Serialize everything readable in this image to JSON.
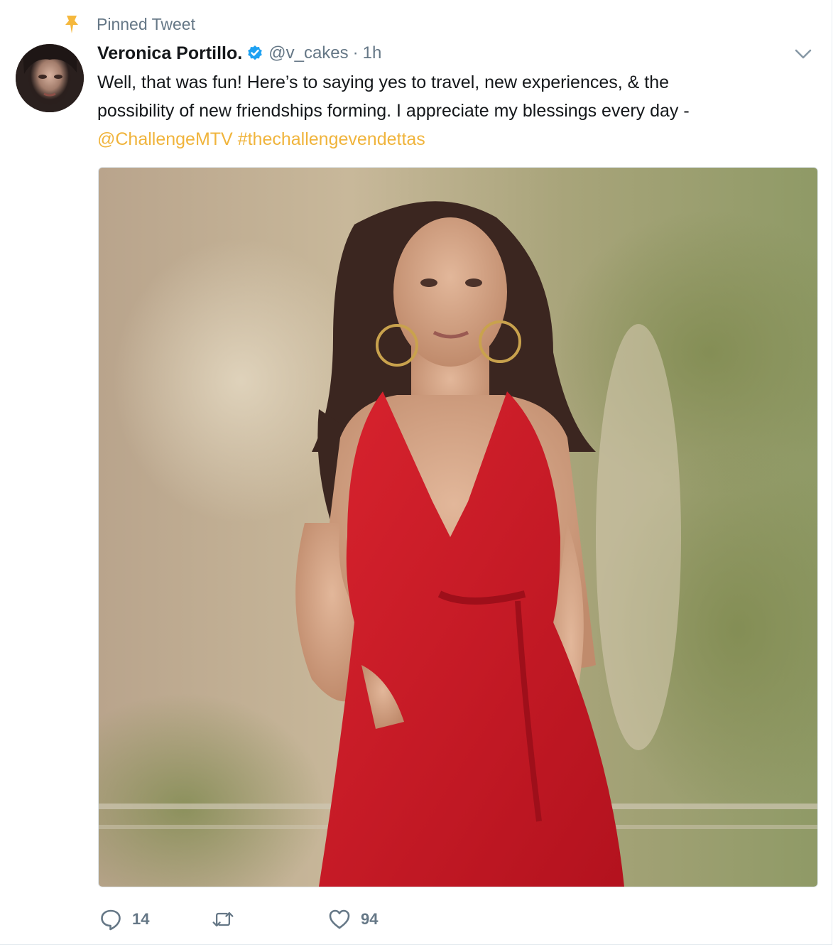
{
  "pinned": {
    "label": "Pinned Tweet",
    "icon": "pin-icon",
    "color": "#f5b83d"
  },
  "author": {
    "display_name": "Veronica Portillo.",
    "handle": "@v_cakes",
    "separator": "·",
    "time": "1h",
    "verified_icon": "verified-badge-icon",
    "verified_color": "#1da1f2"
  },
  "tweet": {
    "line1": "Well, that was fun!  Here’s to saying yes to travel, new experiences, & the",
    "line2": "possibility of new friendships forming.  I appreciate my blessings every day -",
    "mention": "@ChallengeMTV",
    "hashtag": "#thechallengevendettas",
    "link_color": "#f0b43c"
  },
  "actions": {
    "reply": {
      "icon": "reply-icon",
      "count": "14"
    },
    "retweet": {
      "icon": "retweet-icon",
      "count": ""
    },
    "like": {
      "icon": "heart-icon",
      "count": "94"
    }
  },
  "menu": {
    "icon": "chevron-down-icon"
  }
}
